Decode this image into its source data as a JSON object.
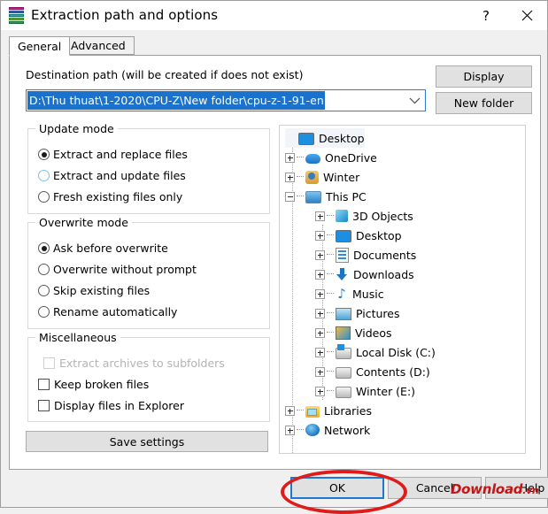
{
  "window": {
    "title": "Extraction path and options",
    "icon": "winrar-books-icon",
    "help_button": "?",
    "close_button": "✕"
  },
  "tabs": [
    {
      "label": "General",
      "selected": true
    },
    {
      "label": "Advanced",
      "selected": false
    }
  ],
  "destination": {
    "label": "Destination path (will be created if does not exist)",
    "value": "D:\\Thu thuat\\1-2020\\CPU-Z\\New folder\\cpu-z-1-91-en",
    "selected_text": true,
    "dropdown_icon": "chevron-down-icon"
  },
  "side_buttons": {
    "display": "Display",
    "new_folder": "New folder"
  },
  "update_mode": {
    "legend": "Update mode",
    "options": [
      {
        "label": "Extract and replace files",
        "checked": true,
        "hover": false
      },
      {
        "label": "Extract and update files",
        "checked": false,
        "hover": true
      },
      {
        "label": "Fresh existing files only",
        "checked": false,
        "hover": false
      }
    ]
  },
  "overwrite_mode": {
    "legend": "Overwrite mode",
    "options": [
      {
        "label": "Ask before overwrite",
        "checked": true
      },
      {
        "label": "Overwrite without prompt",
        "checked": false
      },
      {
        "label": "Skip existing files",
        "checked": false
      },
      {
        "label": "Rename automatically",
        "checked": false
      }
    ]
  },
  "miscellaneous": {
    "legend": "Miscellaneous",
    "options": [
      {
        "label": "Extract archives to subfolders",
        "checked": false,
        "disabled": true
      },
      {
        "label": "Keep broken files",
        "checked": false,
        "disabled": false
      },
      {
        "label": "Display files in Explorer",
        "checked": false,
        "disabled": false
      }
    ]
  },
  "save_settings_button": "Save settings",
  "folder_tree": [
    {
      "label": "Desktop",
      "depth": 0,
      "expander": "none",
      "icon": "monitor-icon",
      "selected": true
    },
    {
      "label": "OneDrive",
      "depth": 0,
      "expander": "plus",
      "icon": "cloud-icon",
      "selected": false
    },
    {
      "label": "Winter",
      "depth": 0,
      "expander": "plus",
      "icon": "user-icon",
      "selected": false
    },
    {
      "label": "This PC",
      "depth": 0,
      "expander": "minus",
      "icon": "computer-icon",
      "selected": false
    },
    {
      "label": "3D Objects",
      "depth": 1,
      "expander": "plus",
      "icon": "cube-icon",
      "selected": false
    },
    {
      "label": "Desktop",
      "depth": 1,
      "expander": "plus",
      "icon": "monitor-icon",
      "selected": false
    },
    {
      "label": "Documents",
      "depth": 1,
      "expander": "plus",
      "icon": "document-icon",
      "selected": false
    },
    {
      "label": "Downloads",
      "depth": 1,
      "expander": "plus",
      "icon": "download-icon",
      "selected": false
    },
    {
      "label": "Music",
      "depth": 1,
      "expander": "plus",
      "icon": "music-icon",
      "selected": false
    },
    {
      "label": "Pictures",
      "depth": 1,
      "expander": "plus",
      "icon": "picture-icon",
      "selected": false
    },
    {
      "label": "Videos",
      "depth": 1,
      "expander": "plus",
      "icon": "video-icon",
      "selected": false
    },
    {
      "label": "Local Disk (C:)",
      "depth": 1,
      "expander": "plus",
      "icon": "windows-disk-icon",
      "selected": false
    },
    {
      "label": "Contents (D:)",
      "depth": 1,
      "expander": "plus",
      "icon": "disk-icon",
      "selected": false
    },
    {
      "label": "Winter (E:)",
      "depth": 1,
      "expander": "plus",
      "icon": "disk-icon",
      "selected": false
    },
    {
      "label": "Libraries",
      "depth": 0,
      "expander": "plus",
      "icon": "library-icon",
      "selected": false
    },
    {
      "label": "Network",
      "depth": 0,
      "expander": "plus",
      "icon": "network-icon",
      "selected": false
    }
  ],
  "footer": {
    "ok": "OK",
    "cancel": "Cancel",
    "help": "Help",
    "ok_focused": true
  },
  "annotation": {
    "shape": "red-ellipse",
    "target": "ok-button",
    "color": "#e01b1b"
  },
  "watermark": {
    "text": "Download",
    "suffix": ".vn",
    "color": "#c01818"
  }
}
